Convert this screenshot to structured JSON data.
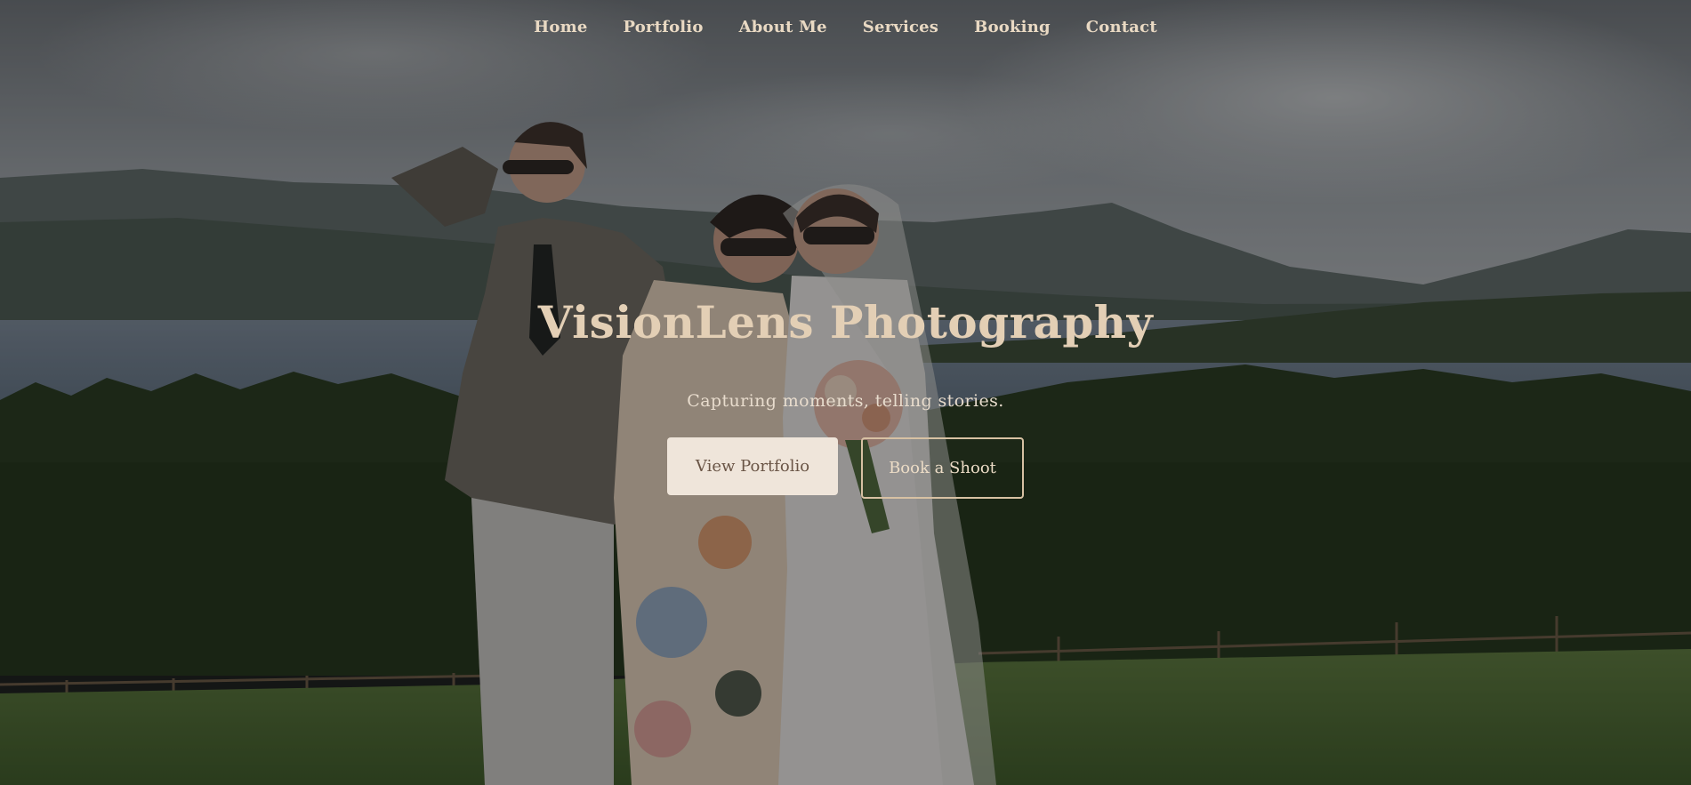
{
  "nav": {
    "items": [
      {
        "label": "Home"
      },
      {
        "label": "Portfolio"
      },
      {
        "label": "About Me"
      },
      {
        "label": "Services"
      },
      {
        "label": "Booking"
      },
      {
        "label": "Contact"
      }
    ]
  },
  "hero": {
    "title": "VisionLens Photography",
    "tagline": "Capturing moments, telling stories.",
    "primary_cta": "View Portfolio",
    "secondary_cta": "Book a Shoot",
    "background_image": "wedding-party-lakeside-photo"
  },
  "colors": {
    "nav_text": "#e9d9c3",
    "title": "#e3cfb5",
    "primary_button_bg": "#efe5da",
    "primary_button_text": "#6a5546",
    "secondary_button_border": "#d7c1a3"
  }
}
